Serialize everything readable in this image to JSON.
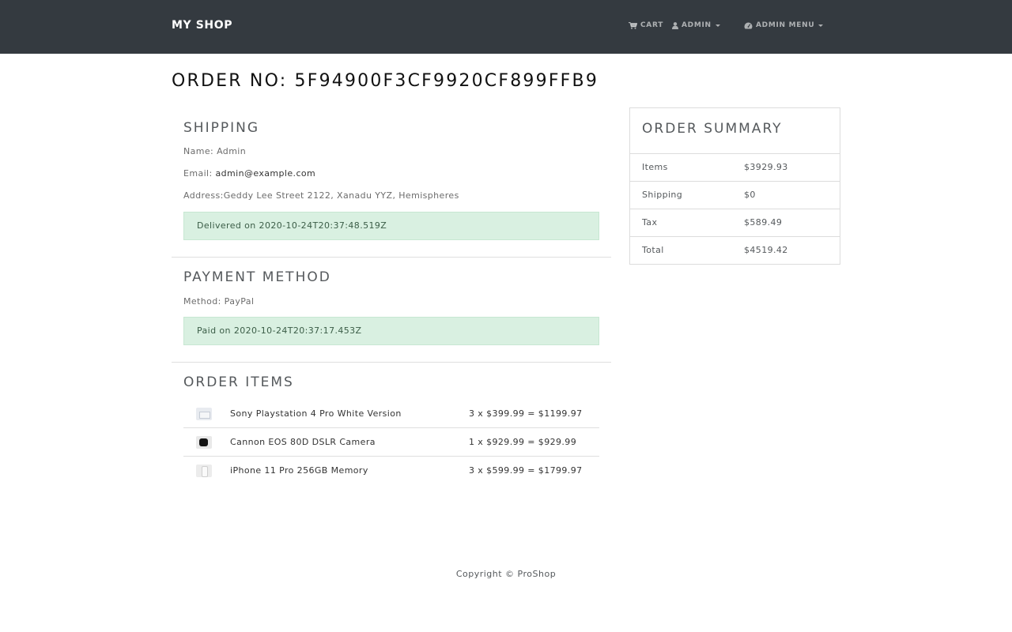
{
  "navbar": {
    "brand": "MY SHOP",
    "cart_label": "CART",
    "user_label": "ADMIN",
    "admin_menu_label": "ADMIN MENU",
    "icons": {
      "cart": "cart-icon",
      "user": "user-icon",
      "admin": "dashboard-icon"
    },
    "background": "#343a40"
  },
  "order": {
    "title": "ORDER NO: 5F94900F3CF9920CF899FFB9"
  },
  "shipping": {
    "heading": "SHIPPING",
    "name_label": "Name:",
    "name_value": "Admin",
    "email_label": "Email:",
    "email_value": "admin@example.com",
    "address_label": "Address:",
    "address_value": "Geddy Lee Street 2122, Xanadu YYZ, Hemispheres",
    "status": "Delivered on 2020-10-24T20:37:48.519Z"
  },
  "payment": {
    "heading": "PAYMENT METHOD",
    "method_label": "Method:",
    "method_value": "PayPal",
    "status": "Paid on 2020-10-24T20:37:17.453Z"
  },
  "order_items": {
    "heading": "ORDER ITEMS",
    "items": [
      {
        "name": "Sony Playstation 4 Pro White Version",
        "price": "3 x $399.99 = $1199.97"
      },
      {
        "name": "Cannon EOS 80D DSLR Camera",
        "price": "1 x $929.99 = $929.99"
      },
      {
        "name": "iPhone 11 Pro 256GB Memory",
        "price": "3 x $599.99 = $1799.97"
      }
    ]
  },
  "summary": {
    "heading": "ORDER SUMMARY",
    "rows": [
      {
        "label": "Items",
        "value": "$3929.93"
      },
      {
        "label": "Shipping",
        "value": "$0"
      },
      {
        "label": "Tax",
        "value": "$589.49"
      },
      {
        "label": "Total",
        "value": "$4519.42"
      }
    ]
  },
  "footer": {
    "copyright": "Copyright © ProShop"
  },
  "colors": {
    "alert_success_bg": "#d9f0e1",
    "text": "#55595c"
  }
}
